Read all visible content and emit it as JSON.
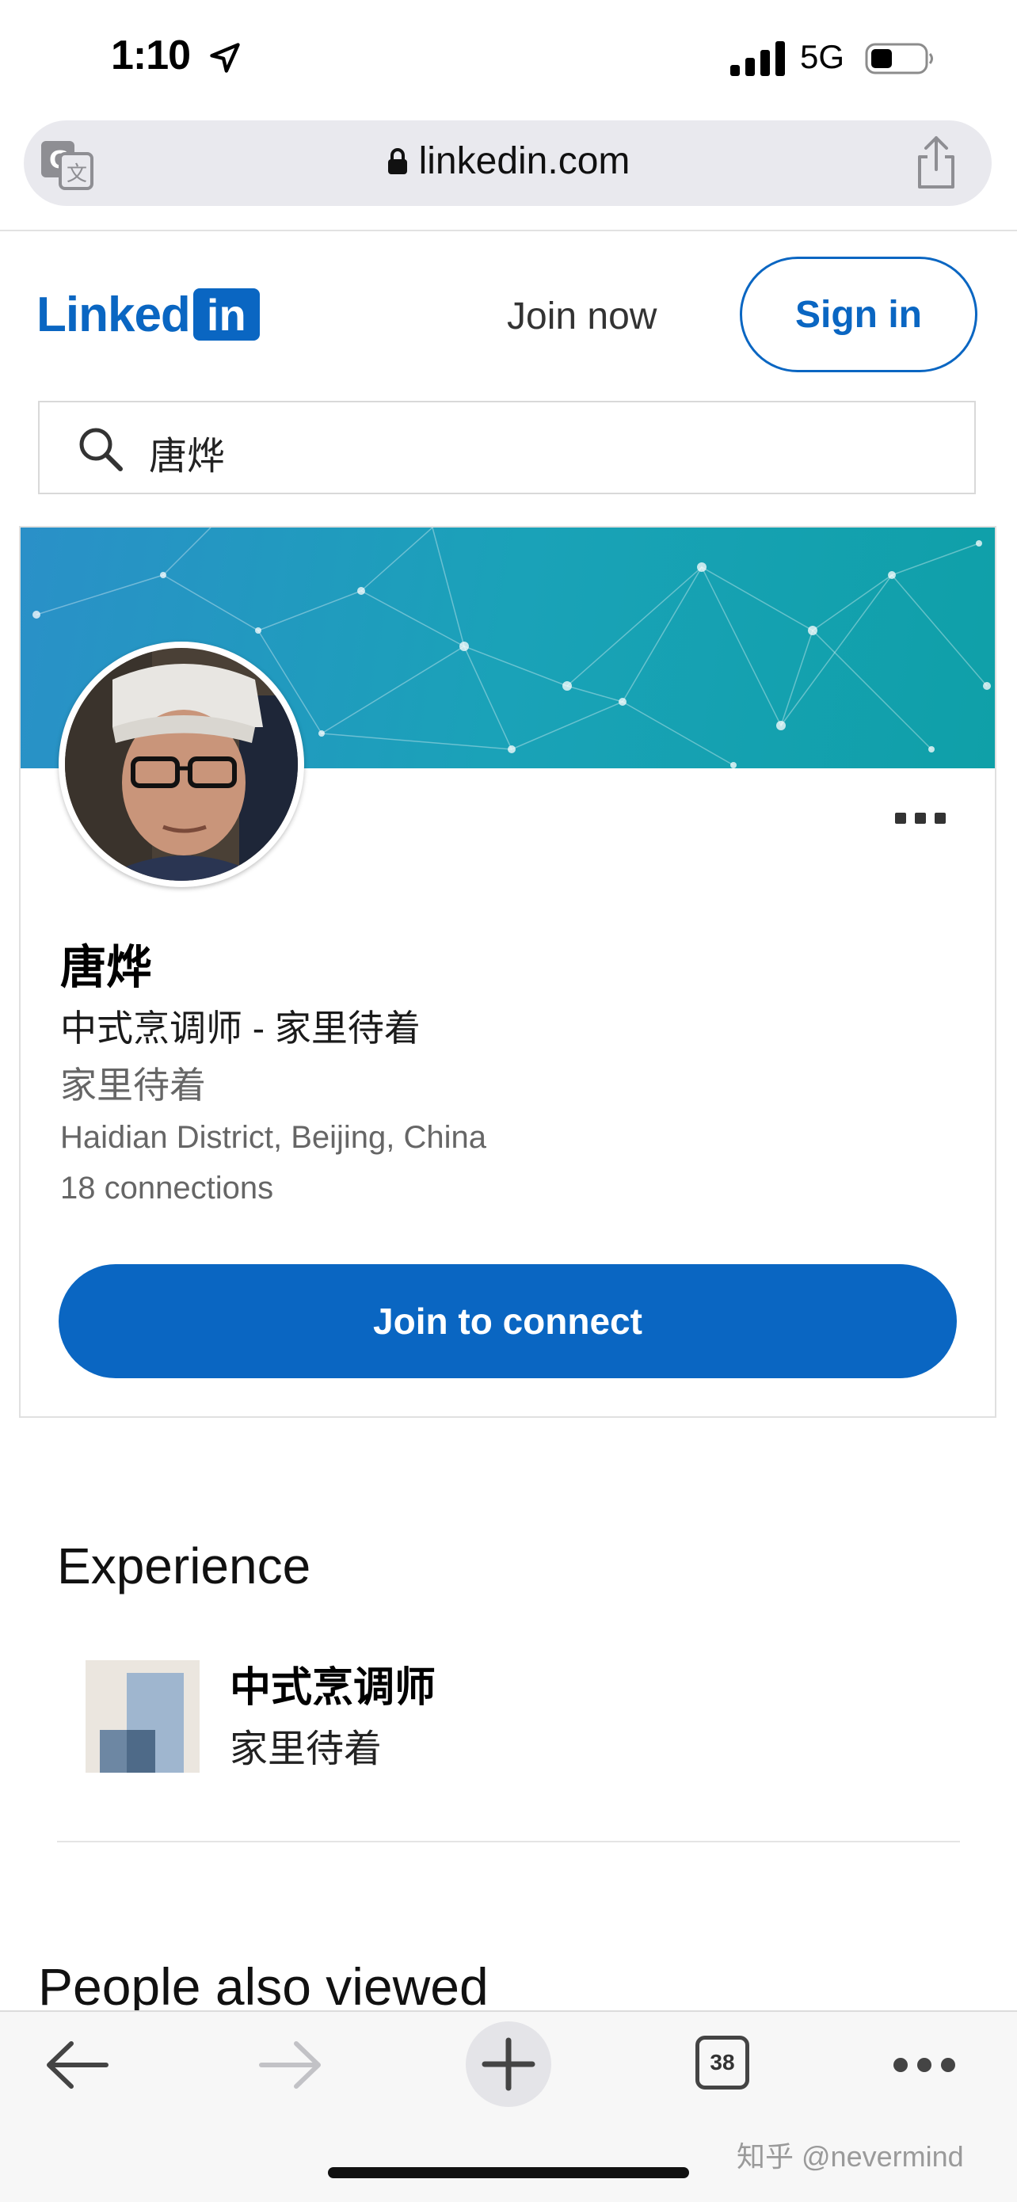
{
  "status_bar": {
    "time": "1:10",
    "network": "5G"
  },
  "browser": {
    "url": "linkedin.com",
    "tab_count": "38"
  },
  "header": {
    "logo_text": "Linked",
    "logo_box": "in",
    "join_now": "Join now",
    "sign_in": "Sign in"
  },
  "search": {
    "value": "唐烨"
  },
  "profile": {
    "name": "唐烨",
    "headline": "中式烹调师 - 家里待着",
    "company": "家里待着",
    "location": "Haidian District, Beijing, China",
    "connections": "18 connections",
    "join_button": "Join to connect"
  },
  "experience": {
    "title": "Experience",
    "items": [
      {
        "role": "中式烹调师",
        "company": "家里待着"
      }
    ]
  },
  "people_also_viewed": {
    "title": "People also viewed"
  },
  "watermark": "知乎 @nevermind",
  "colors": {
    "brand": "#0a66c2",
    "banner_start": "#2a90c8",
    "banner_end": "#0fa0a8"
  }
}
